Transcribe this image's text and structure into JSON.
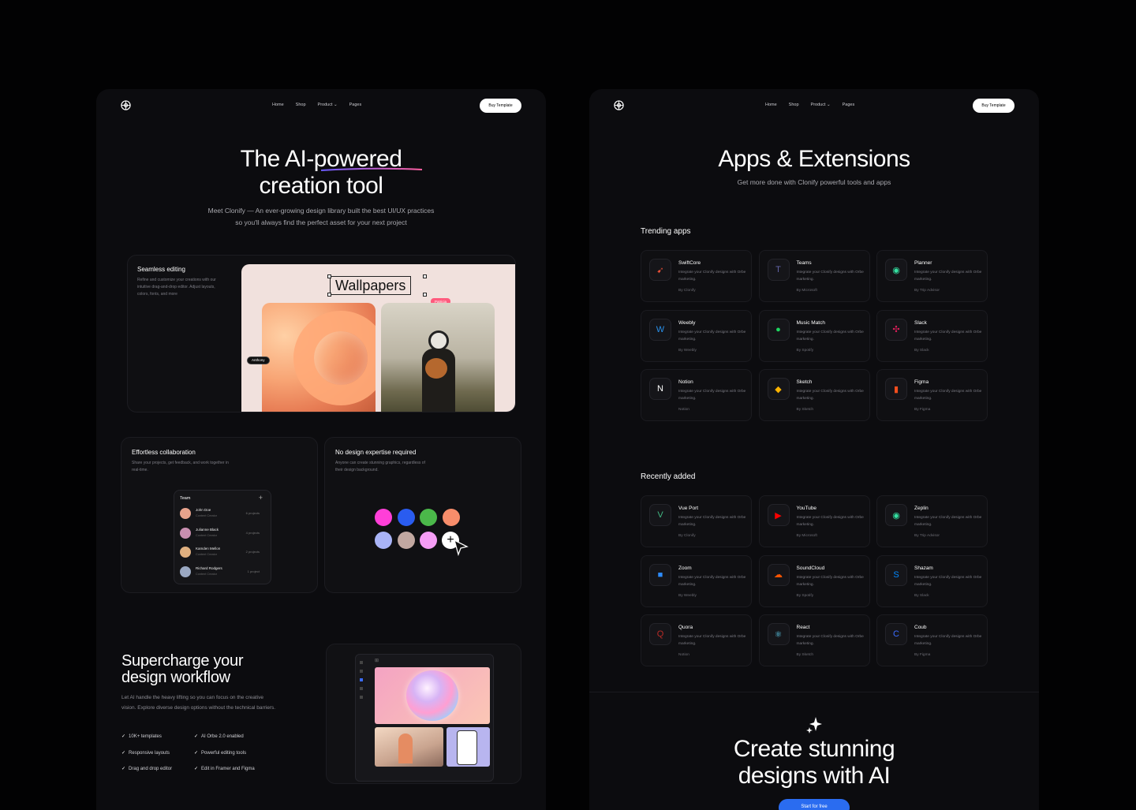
{
  "left": {
    "nav": {
      "links": [
        "Home",
        "Shop",
        "Product",
        "Pages"
      ],
      "buy": "Buy Template"
    },
    "hero": {
      "title_line1": "The AI-powered",
      "title_line2": "creation tool",
      "sub_line1": "Meet Clonify — An ever-growing design library built the best UI/UX practices",
      "sub_line2": "so you'll always find the perfect asset for your next project"
    },
    "editing": {
      "title": "Seamless editing",
      "desc": "Refine and customize your creations with our intuitive drag-and-drop editor. Adjust layouts, colors, fonts, and more",
      "wallpapers": "Wallpapers",
      "tag_patricia": "Patricia",
      "tag_anthony": "Anthony"
    },
    "collab": {
      "title": "Effortless collaboration",
      "desc": "Share your projects, get feedback, and work together in real-time.",
      "team_label": "Team",
      "plus": "+",
      "members": [
        {
          "name": "John Doe",
          "role": "Content Creator",
          "projects": "6 projects",
          "color": "#e8a38c"
        },
        {
          "name": "Julianne Black",
          "role": "Content Creator",
          "projects": "4 projects",
          "color": "#c98fb0"
        },
        {
          "name": "Kamden Mellon",
          "role": "Content Creator",
          "projects": "2 projects",
          "color": "#e0b080"
        },
        {
          "name": "Richard Rodgers",
          "role": "Content Creator",
          "projects": "1 project",
          "color": "#9aa8c2"
        }
      ]
    },
    "expertise": {
      "title": "No design expertise required",
      "desc": "Anyone can create stunning graphics, regardless of their design background.",
      "colors_row1": [
        "#ff3fd8",
        "#2a5cf0",
        "#4bb84a",
        "#f78d6b"
      ],
      "colors_row2": [
        "#a9b4f7",
        "#c2a8a1",
        "#f59df5"
      ]
    },
    "workflow": {
      "title_line1": "Supercharge your",
      "title_line2": "design workflow",
      "desc": "Let AI handle the heavy lifting so you can focus on the creative vision. Explore diverse design options without the technical barriers.",
      "features": [
        "10K+ templates",
        "AI Orbe 2.0 enabled",
        "Responsive layouts",
        "Powerful editing tools",
        "Drag and drop editor",
        "Edit in Framer and Figma"
      ]
    }
  },
  "right": {
    "nav": {
      "links": [
        "Home",
        "Shop",
        "Product",
        "Pages"
      ],
      "buy": "Buy Template"
    },
    "hero": {
      "title": "Apps & Extensions",
      "sub": "Get more done with Clonify powerful tools and apps"
    },
    "trending_label": "Trending apps",
    "trending": [
      {
        "name": "SwiftCore",
        "desc": "Integrate your Clonify designs with Orbe marketing.",
        "by": "By Clonify",
        "icon": "swift-icon",
        "glyph": "➹",
        "color": "#f05138"
      },
      {
        "name": "Teams",
        "desc": "Integrate your Clonify designs with Orbe marketing.",
        "by": "By Microsoft",
        "icon": "teams-icon",
        "glyph": "T",
        "color": "#6264a7"
      },
      {
        "name": "Planner",
        "desc": "Integrate your Clonify designs with Orbe marketing.",
        "by": "By Trip Advisor",
        "icon": "planner-icon",
        "glyph": "◉",
        "color": "#34e0a1"
      },
      {
        "name": "Weebly",
        "desc": "Integrate your Clonify designs with Orbe marketing.",
        "by": "By Weebly",
        "icon": "weebly-icon",
        "glyph": "W",
        "color": "#2990ea"
      },
      {
        "name": "Music Match",
        "desc": "Integrate your Clonify designs with Orbe marketing.",
        "by": "By Spotify",
        "icon": "spotify-icon",
        "glyph": "●",
        "color": "#1ed760"
      },
      {
        "name": "Slack",
        "desc": "Integrate your Clonify designs with Orbe marketing.",
        "by": "By Slack",
        "icon": "slack-icon",
        "glyph": "✣",
        "color": "#e01e5a"
      },
      {
        "name": "Notion",
        "desc": "Integrate your Clonify designs with Orbe marketing.",
        "by": "Notion",
        "icon": "notion-icon",
        "glyph": "N",
        "color": "#ffffff"
      },
      {
        "name": "Sketch",
        "desc": "Integrate your Clonify designs with Orbe marketing.",
        "by": "By Sketch",
        "icon": "sketch-icon",
        "glyph": "◆",
        "color": "#fdb300"
      },
      {
        "name": "Figma",
        "desc": "Integrate your Clonify designs with Orbe marketing.",
        "by": "By Figma",
        "icon": "figma-icon",
        "glyph": "▮",
        "color": "#f24e1e"
      }
    ],
    "recent_label": "Recently added",
    "recent": [
      {
        "name": "Vue Port",
        "desc": "Integrate your Clonify designs with Orbe marketing.",
        "by": "By Clonify",
        "icon": "vue-icon",
        "glyph": "V",
        "color": "#41b883"
      },
      {
        "name": "YouTube",
        "desc": "Integrate your Clonify designs with Orbe marketing.",
        "by": "By Microsoft",
        "icon": "youtube-icon",
        "glyph": "▶",
        "color": "#ff0000"
      },
      {
        "name": "Zeplin",
        "desc": "Integrate your Clonify designs with Orbe marketing.",
        "by": "By Trip Advisor",
        "icon": "zeplin-icon",
        "glyph": "◉",
        "color": "#34e0a1"
      },
      {
        "name": "Zoom",
        "desc": "Integrate your Clonify designs with Orbe marketing.",
        "by": "By Weebly",
        "icon": "zoom-icon",
        "glyph": "■",
        "color": "#2d8cff"
      },
      {
        "name": "SoundCloud",
        "desc": "Integrate your Clonify designs with Orbe marketing.",
        "by": "By Spotify",
        "icon": "soundcloud-icon",
        "glyph": "☁",
        "color": "#ff5500"
      },
      {
        "name": "Shazam",
        "desc": "Integrate your Clonify designs with Orbe marketing.",
        "by": "By Slack",
        "icon": "shazam-icon",
        "glyph": "S",
        "color": "#0088ff"
      },
      {
        "name": "Quora",
        "desc": "Integrate your Clonify designs with Orbe marketing.",
        "by": "Notion",
        "icon": "quora-icon",
        "glyph": "Q",
        "color": "#b92b27"
      },
      {
        "name": "React",
        "desc": "Integrate your Clonify designs with Orbe marketing.",
        "by": "By Sketch",
        "icon": "react-icon",
        "glyph": "⚛",
        "color": "#61dafb"
      },
      {
        "name": "Coub",
        "desc": "Integrate your Clonify designs with Orbe marketing.",
        "by": "By Figma",
        "icon": "coub-icon",
        "glyph": "C",
        "color": "#3b6cff"
      }
    ],
    "cta": {
      "title_line1": "Create stunning",
      "title_line2": "designs with AI",
      "button": "Start for free"
    }
  }
}
